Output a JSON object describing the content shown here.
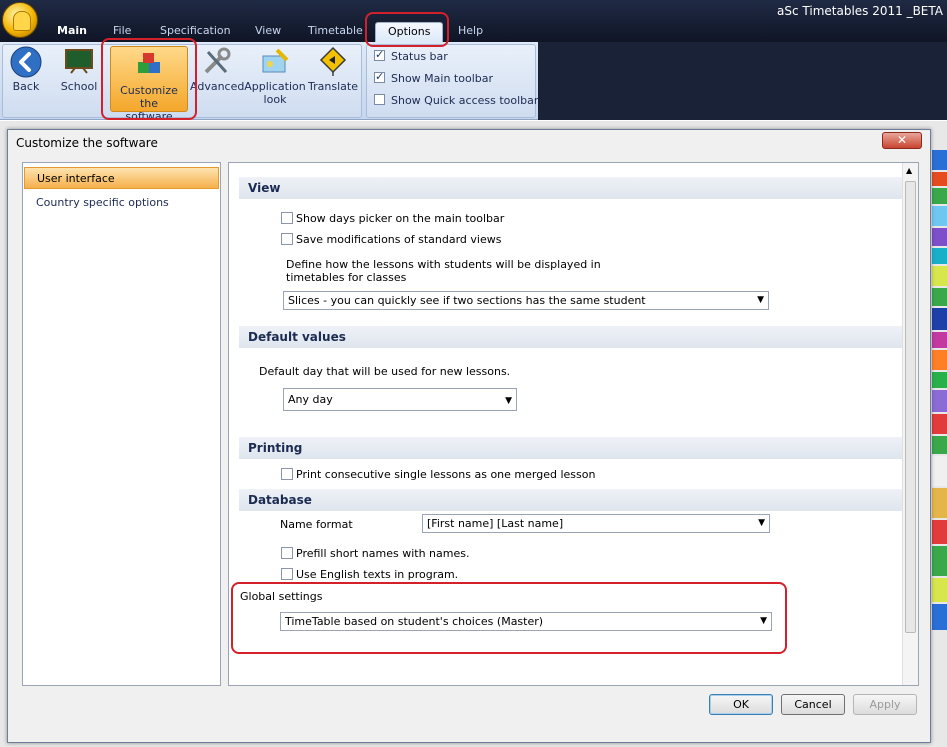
{
  "window": {
    "title": "aSc Timetables 2011 _BETA"
  },
  "menu": {
    "tabs": [
      "Main",
      "File",
      "Specification",
      "View",
      "Timetable",
      "Options",
      "Help"
    ],
    "active": "Options"
  },
  "ribbon": {
    "back": "Back",
    "school": "School",
    "customize_line1": "Customize the",
    "customize_line2": "software",
    "advanced": "Advanced",
    "applook_line1": "Application",
    "applook_line2": "look",
    "translate": "Translate",
    "checks": [
      {
        "label": "Status bar",
        "checked": true
      },
      {
        "label": "Show Main toolbar",
        "checked": true
      },
      {
        "label": "Show Quick access toolbar",
        "checked": false
      }
    ]
  },
  "dialog": {
    "title": "Customize the software",
    "close_symbol": "✕",
    "side_items": [
      "User interface",
      "Country specific options"
    ],
    "sections": {
      "view": {
        "title": "View",
        "show_days_picker": "Show days picker on the main toolbar",
        "save_mods": "Save modifications of standard views",
        "define_line1": "Define how the lessons with students will be displayed in",
        "define_line2": "timetables for classes",
        "display_mode": "Slices - you can quickly see if two sections has the same student"
      },
      "defaults": {
        "title": "Default values",
        "default_day_label": "Default day that will be used for new lessons.",
        "default_day": "Any day"
      },
      "printing": {
        "title": "Printing",
        "merge": "Print consecutive single lessons as one merged lesson"
      },
      "database": {
        "title": "Database",
        "name_format_label": "Name format",
        "name_format": "[First name] [Last name]",
        "prefill": "Prefill short names with names.",
        "english": "Use English texts in program."
      },
      "global": {
        "title": "Global settings",
        "value": "TimeTable based on student's choices (Master)"
      }
    },
    "buttons": {
      "ok": "OK",
      "cancel": "Cancel",
      "apply": "Apply"
    }
  }
}
